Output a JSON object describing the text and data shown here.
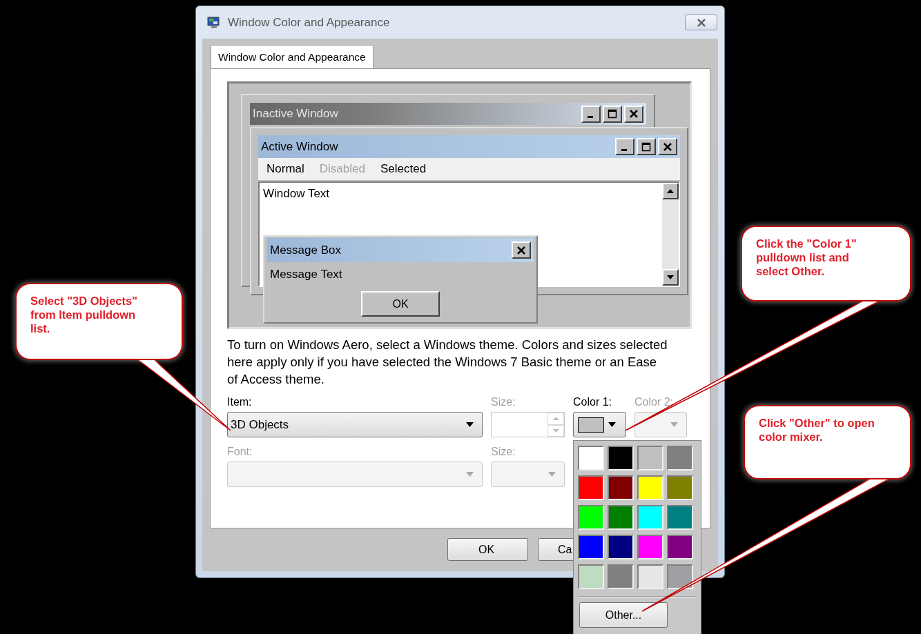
{
  "window": {
    "title": "Window Color and Appearance"
  },
  "tabs": [
    {
      "label": "Window Color and Appearance",
      "selected": true
    }
  ],
  "preview": {
    "inactive_window": {
      "title": "Inactive Window"
    },
    "active_window": {
      "title": "Active Window",
      "menu": [
        {
          "label": "Normal",
          "disabled": false
        },
        {
          "label": "Disabled",
          "disabled": true
        },
        {
          "label": "Selected",
          "disabled": false
        }
      ],
      "text": "Window Text"
    },
    "message_box": {
      "title": "Message Box",
      "text": "Message Text",
      "button": "OK"
    }
  },
  "description": "To turn on Windows Aero, select a Windows theme.  Colors and sizes selected here apply only if you have selected the Windows 7 Basic theme or an Ease of Access theme.",
  "rows": [
    {
      "fields": [
        {
          "kind": "select",
          "label": "Item:",
          "value": "3D Objects",
          "disabled": false
        },
        {
          "kind": "spin",
          "label": "Size:",
          "disabled": true
        },
        {
          "kind": "color",
          "label": "Color 1:",
          "color": "#c0c0c0",
          "disabled": false
        },
        {
          "kind": "select",
          "label": "Color 2:",
          "disabled": true
        }
      ]
    },
    {
      "fields": [
        {
          "kind": "select",
          "label": "Font:",
          "disabled": true
        },
        {
          "kind": "select",
          "label": "Size:",
          "disabled": true
        }
      ]
    }
  ],
  "buttons": [
    {
      "label": "OK"
    },
    {
      "label": "Ca"
    }
  ],
  "palette": {
    "swatches": [
      {
        "color": "#ffffff"
      },
      {
        "color": "#000000"
      },
      {
        "color": "#c0c0c0"
      },
      {
        "color": "#808080"
      },
      {
        "color": "#ff0000"
      },
      {
        "color": "#800000"
      },
      {
        "color": "#ffff00"
      },
      {
        "color": "#808000"
      },
      {
        "color": "#00ff00"
      },
      {
        "color": "#008000"
      },
      {
        "color": "#00ffff"
      },
      {
        "color": "#008080"
      },
      {
        "color": "#0000ff"
      },
      {
        "color": "#000080"
      },
      {
        "color": "#ff00ff"
      },
      {
        "color": "#800080"
      },
      {
        "color": "#c0dcc0"
      },
      {
        "color": "#808080"
      },
      {
        "color": "#e6e6e6"
      },
      {
        "color": "#a0a0a4"
      }
    ],
    "button": "Other..."
  },
  "callouts": [
    {
      "text": "Select \"3D Objects\" from Item pulldown list."
    },
    {
      "text": "Click the \"Color 1\" pulldown list and select Other."
    },
    {
      "text": "Click \"Other\" to open color mixer."
    }
  ]
}
